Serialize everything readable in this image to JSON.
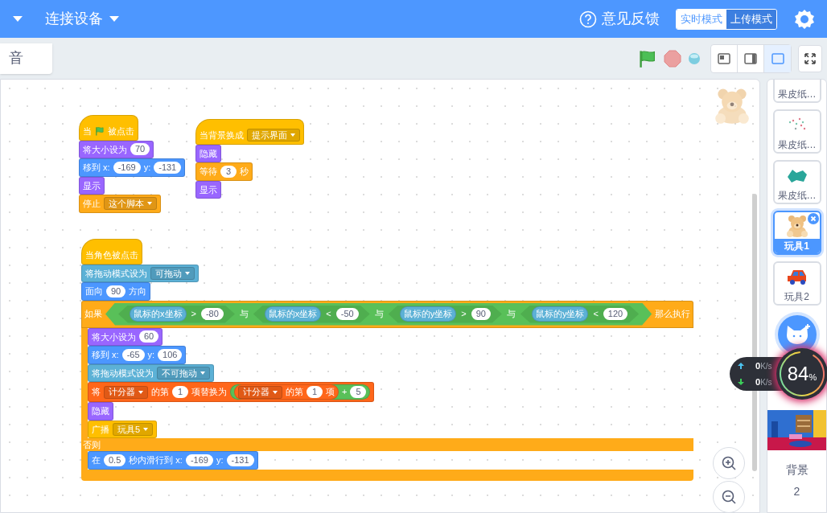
{
  "menu_bar": {
    "items": [
      {
        "label": "连接设备"
      }
    ],
    "feedback": "意见反馈",
    "modes": [
      {
        "label": "实时模式",
        "selected": true
      },
      {
        "label": "上传模式",
        "selected": false
      }
    ]
  },
  "toolbar": {
    "tab": "音",
    "layouts": [
      {
        "selected": false
      },
      {
        "selected": false
      },
      {
        "selected": true
      }
    ]
  },
  "scripts": [
    {
      "blocks": [
        {
          "color": "#ffbf00",
          "hat": true,
          "parts": [
            {
              "kind": "text",
              "text": "当"
            },
            {
              "kind": "flag"
            },
            {
              "kind": "text",
              "text": "被点击"
            }
          ]
        },
        {
          "color": "#9966ff",
          "hat": false,
          "parts": [
            {
              "kind": "text",
              "text": "将大小设为"
            },
            {
              "kind": "num",
              "text": "70"
            }
          ]
        },
        {
          "color": "#4c97ff",
          "hat": false,
          "parts": [
            {
              "kind": "text",
              "text": "移到 x:"
            },
            {
              "kind": "num",
              "text": "-169"
            },
            {
              "kind": "text",
              "text": "y:"
            },
            {
              "kind": "num",
              "text": "-131"
            }
          ]
        },
        {
          "color": "#9966ff",
          "hat": false,
          "parts": [
            {
              "kind": "text",
              "text": "显示"
            }
          ]
        },
        {
          "color": "#ffab19",
          "hat": false,
          "parts": [
            {
              "kind": "text",
              "text": "停止"
            },
            {
              "kind": "menu",
              "text": "这个脚本"
            }
          ]
        }
      ]
    },
    {
      "blocks": [
        {
          "color": "#ffbf00",
          "hat": true,
          "parts": [
            {
              "kind": "text",
              "text": "当背景换成"
            },
            {
              "kind": "menu",
              "text": "提示界面"
            }
          ]
        },
        {
          "color": "#9966ff",
          "hat": false,
          "parts": [
            {
              "kind": "text",
              "text": "隐藏"
            }
          ]
        },
        {
          "color": "#ffab19",
          "hat": false,
          "parts": [
            {
              "kind": "text",
              "text": "等待"
            },
            {
              "kind": "num",
              "text": "3"
            },
            {
              "kind": "text",
              "text": "秒"
            }
          ]
        },
        {
          "color": "#9966ff",
          "hat": false,
          "parts": [
            {
              "kind": "text",
              "text": "显示"
            }
          ]
        }
      ]
    },
    {
      "blocks": [
        {
          "color": "#ffbf00",
          "hat": true,
          "parts": [
            {
              "kind": "text",
              "text": "当角色被点击"
            }
          ]
        },
        {
          "color": "#5cb1d6",
          "hat": false,
          "parts": [
            {
              "kind": "text",
              "text": "将拖动模式设为"
            },
            {
              "kind": "menu",
              "text": "可拖动"
            }
          ]
        },
        {
          "color": "#4c97ff",
          "hat": false,
          "parts": [
            {
              "kind": "text",
              "text": "面向"
            },
            {
              "kind": "num",
              "text": "90"
            },
            {
              "kind": "text",
              "text": "方向"
            }
          ]
        },
        {
          "color": "#ffab19",
          "kind": "if_else",
          "parts": [
            {
              "kind": "text",
              "text": "如果"
            },
            {
              "kind": "bool",
              "parts": [
                {
                  "kind": "bool",
                  "parts": [
                    {
                      "kind": "reporter",
                      "color": "#5cb1d6",
                      "parts": [
                        {
                          "kind": "text",
                          "text": "鼠标的x坐标"
                        }
                      ]
                    },
                    {
                      "kind": "text",
                      "text": ">"
                    },
                    {
                      "kind": "num",
                      "text": "-80"
                    }
                  ]
                },
                {
                  "kind": "text",
                  "text": "与"
                },
                {
                  "kind": "bool",
                  "parts": [
                    {
                      "kind": "reporter",
                      "color": "#5cb1d6",
                      "parts": [
                        {
                          "kind": "text",
                          "text": "鼠标的x坐标"
                        }
                      ]
                    },
                    {
                      "kind": "text",
                      "text": "<"
                    },
                    {
                      "kind": "num",
                      "text": "-50"
                    }
                  ]
                },
                {
                  "kind": "text",
                  "text": "与"
                },
                {
                  "kind": "bool",
                  "parts": [
                    {
                      "kind": "reporter",
                      "color": "#5cb1d6",
                      "parts": [
                        {
                          "kind": "text",
                          "text": "鼠标的y坐标"
                        }
                      ]
                    },
                    {
                      "kind": "text",
                      "text": ">"
                    },
                    {
                      "kind": "num",
                      "text": "90"
                    }
                  ]
                },
                {
                  "kind": "text",
                  "text": "与"
                },
                {
                  "kind": "bool",
                  "parts": [
                    {
                      "kind": "reporter",
                      "color": "#5cb1d6",
                      "parts": [
                        {
                          "kind": "text",
                          "text": "鼠标的y坐标"
                        }
                      ]
                    },
                    {
                      "kind": "text",
                      "text": "<"
                    },
                    {
                      "kind": "num",
                      "text": "120"
                    }
                  ]
                }
              ]
            },
            {
              "kind": "text",
              "text": "那么执行"
            }
          ],
          "then": [
            {
              "color": "#9966ff",
              "hat": false,
              "parts": [
                {
                  "kind": "text",
                  "text": "将大小设为"
                },
                {
                  "kind": "num",
                  "text": "60"
                }
              ]
            },
            {
              "color": "#4c97ff",
              "hat": false,
              "parts": [
                {
                  "kind": "text",
                  "text": "移到 x:"
                },
                {
                  "kind": "num",
                  "text": "-65"
                },
                {
                  "kind": "text",
                  "text": "y:"
                },
                {
                  "kind": "num",
                  "text": "106"
                }
              ]
            },
            {
              "color": "#5cb1d6",
              "hat": false,
              "parts": [
                {
                  "kind": "text",
                  "text": "将拖动模式设为"
                },
                {
                  "kind": "menu",
                  "text": "不可拖动"
                }
              ]
            },
            {
              "color": "#ff661a",
              "hat": false,
              "parts": [
                {
                  "kind": "text",
                  "text": "将"
                },
                {
                  "kind": "menu",
                  "text": "计分器"
                },
                {
                  "kind": "text",
                  "text": "的第"
                },
                {
                  "kind": "num",
                  "text": "1"
                },
                {
                  "kind": "text",
                  "text": "项替换为"
                },
                {
                  "kind": "reporter",
                  "color": "#59c059",
                  "parts": [
                    {
                      "kind": "reporter",
                      "color": "#ff661a",
                      "parts": [
                        {
                          "kind": "menu",
                          "text": "计分器"
                        },
                        {
                          "kind": "text",
                          "text": "的第"
                        },
                        {
                          "kind": "num",
                          "text": "1"
                        },
                        {
                          "kind": "text",
                          "text": "项"
                        }
                      ]
                    },
                    {
                      "kind": "text",
                      "text": "+"
                    },
                    {
                      "kind": "num",
                      "text": "5"
                    }
                  ]
                }
              ]
            },
            {
              "color": "#9966ff",
              "hat": false,
              "parts": [
                {
                  "kind": "text",
                  "text": "隐藏"
                }
              ]
            },
            {
              "color": "#ffbf00",
              "hat": false,
              "parts": [
                {
                  "kind": "text",
                  "text": "广播"
                },
                {
                  "kind": "menu",
                  "text": "玩具5"
                }
              ]
            }
          ],
          "else_label": "否则",
          "else": [
            {
              "color": "#4c97ff",
              "hat": false,
              "parts": [
                {
                  "kind": "text",
                  "text": "在"
                },
                {
                  "kind": "num",
                  "text": "0.5"
                },
                {
                  "kind": "text",
                  "text": "秒内滑行到 x:"
                },
                {
                  "kind": "num",
                  "text": "-169"
                },
                {
                  "kind": "text",
                  "text": "y:"
                },
                {
                  "kind": "num",
                  "text": "-131"
                }
              ]
            }
          ]
        }
      ]
    }
  ],
  "sprites": [
    {
      "name": "果皮纸…",
      "selected": false
    },
    {
      "name": "果皮纸…",
      "selected": false
    },
    {
      "name": "果皮纸…",
      "selected": false
    },
    {
      "name": "玩具1",
      "selected": true
    },
    {
      "name": "玩具2",
      "selected": false
    }
  ],
  "stage": {
    "label": "背景",
    "count": "2"
  },
  "net": {
    "up": {
      "value": "0",
      "unit": "K/s"
    },
    "down": {
      "value": "0",
      "unit": "K/s"
    },
    "percent": "84",
    "percent_unit": "%"
  }
}
